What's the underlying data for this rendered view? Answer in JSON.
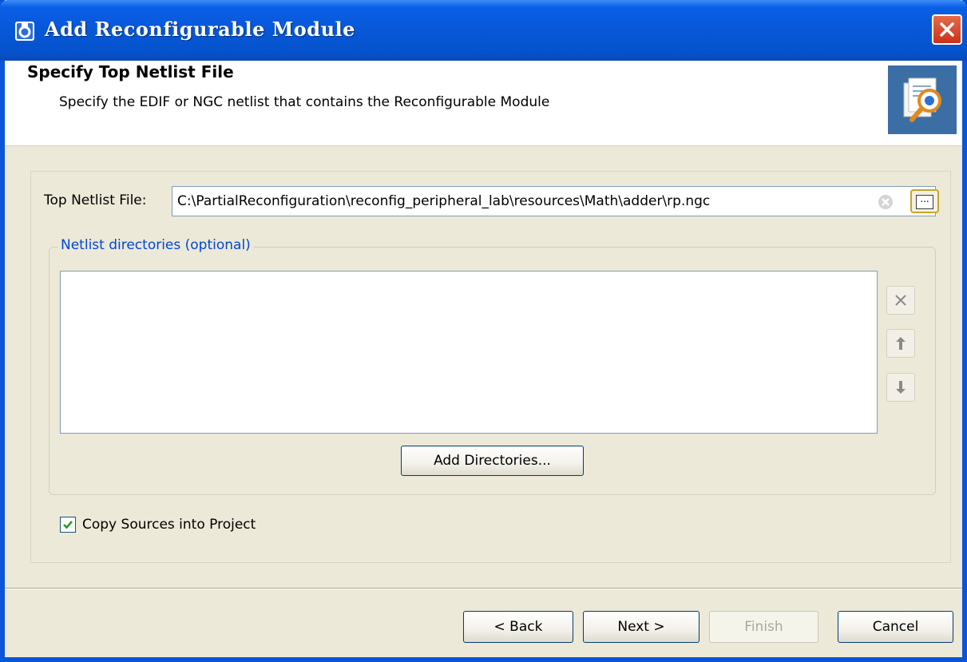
{
  "window": {
    "title": "Add Reconfigurable Module",
    "close_icon": "close-icon"
  },
  "header": {
    "title": "Specify Top Netlist File",
    "subtitle": "Specify the EDIF or NGC netlist that contains the Reconfigurable Module",
    "icon": "wizard-document-icon"
  },
  "netlist": {
    "label": "Top Netlist File:",
    "value": "C:\\PartialReconfiguration\\reconfig_peripheral_lab\\resources\\Math\\adder\\rp.ngc",
    "browse_label": "..."
  },
  "directories": {
    "group_label": "Netlist directories (optional)",
    "items": [],
    "add_button": "Add Directories...",
    "side_buttons": [
      "remove-icon",
      "move-up-icon",
      "move-down-icon"
    ]
  },
  "copy_sources": {
    "label": "Copy Sources into Project",
    "checked": true
  },
  "footer": {
    "back": "< Back",
    "next": "Next >",
    "finish": "Finish",
    "cancel": "Cancel"
  },
  "colors": {
    "titlebar": "#0757d8",
    "dialog_bg": "#ece9d8",
    "group_label": "#0046d5",
    "close_button": "#c9321a"
  }
}
